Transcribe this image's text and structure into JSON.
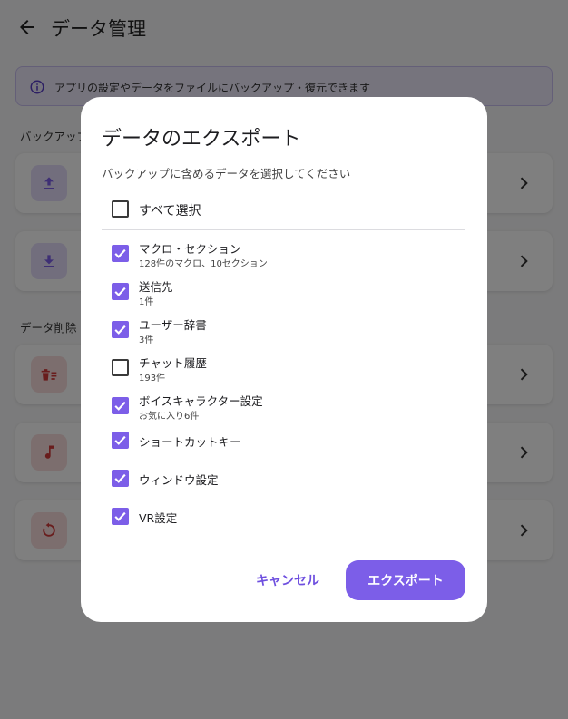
{
  "header": {
    "title": "データ管理"
  },
  "banner": {
    "text": "アプリの設定やデータをファイルにバックアップ・復元できます"
  },
  "sections": {
    "backup": "バックアップ",
    "delete": "データ削除"
  },
  "dialog": {
    "title": "データのエクスポート",
    "description": "バックアップに含めるデータを選択してください",
    "select_all": {
      "label": "すべて選択",
      "checked": false
    },
    "options": [
      {
        "label": "マクロ・セクション",
        "sub": "128件のマクロ、10セクション",
        "checked": true
      },
      {
        "label": "送信先",
        "sub": "1件",
        "checked": true
      },
      {
        "label": "ユーザー辞書",
        "sub": "3件",
        "checked": true
      },
      {
        "label": "チャット履歴",
        "sub": "193件",
        "checked": false
      },
      {
        "label": "ボイスキャラクター設定",
        "sub": "お気に入り6件",
        "checked": true
      },
      {
        "label": "ショートカットキー",
        "sub": "",
        "checked": true
      },
      {
        "label": "ウィンドウ設定",
        "sub": "",
        "checked": true
      },
      {
        "label": "VR設定",
        "sub": "",
        "checked": true
      }
    ],
    "cancel_label": "キャンセル",
    "export_label": "エクスポート"
  },
  "colors": {
    "accent": "#7c5ee8",
    "accent_text": "#6e4fdf",
    "danger": "#d23a3a"
  }
}
